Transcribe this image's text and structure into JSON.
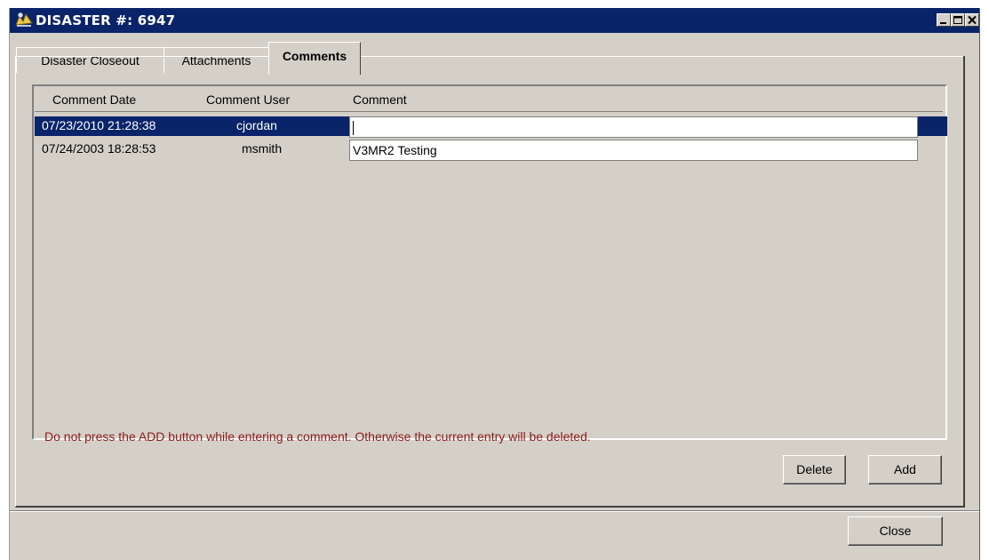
{
  "window": {
    "title": "DISASTER #: 6947",
    "controls": [
      "minimize-icon",
      "maximize-icon",
      "close-icon"
    ]
  },
  "tabs": [
    {
      "label": "Disaster Closeout",
      "active": false
    },
    {
      "label": "Attachments",
      "active": false
    },
    {
      "label": "Comments",
      "active": true
    }
  ],
  "list": {
    "columns": [
      "Comment Date",
      "Comment User",
      "Comment"
    ],
    "rows": [
      {
        "date": "07/23/2010 21:28:38",
        "user": "cjordan",
        "comment": "",
        "selected": true
      },
      {
        "date": "07/24/2003 18:28:53",
        "user": "msmith",
        "comment": "V3MR2 Testing",
        "selected": false
      }
    ]
  },
  "warning": "Do not press the ADD button while entering a comment. Otherwise the current entry will be deleted.",
  "buttons": {
    "delete": "Delete",
    "add": "Add",
    "close": "Close"
  },
  "colors": {
    "titlebar": "#0a246a",
    "selection": "#0a246a",
    "warning_text": "#8b1a1a",
    "face": "#d4d0c8"
  }
}
